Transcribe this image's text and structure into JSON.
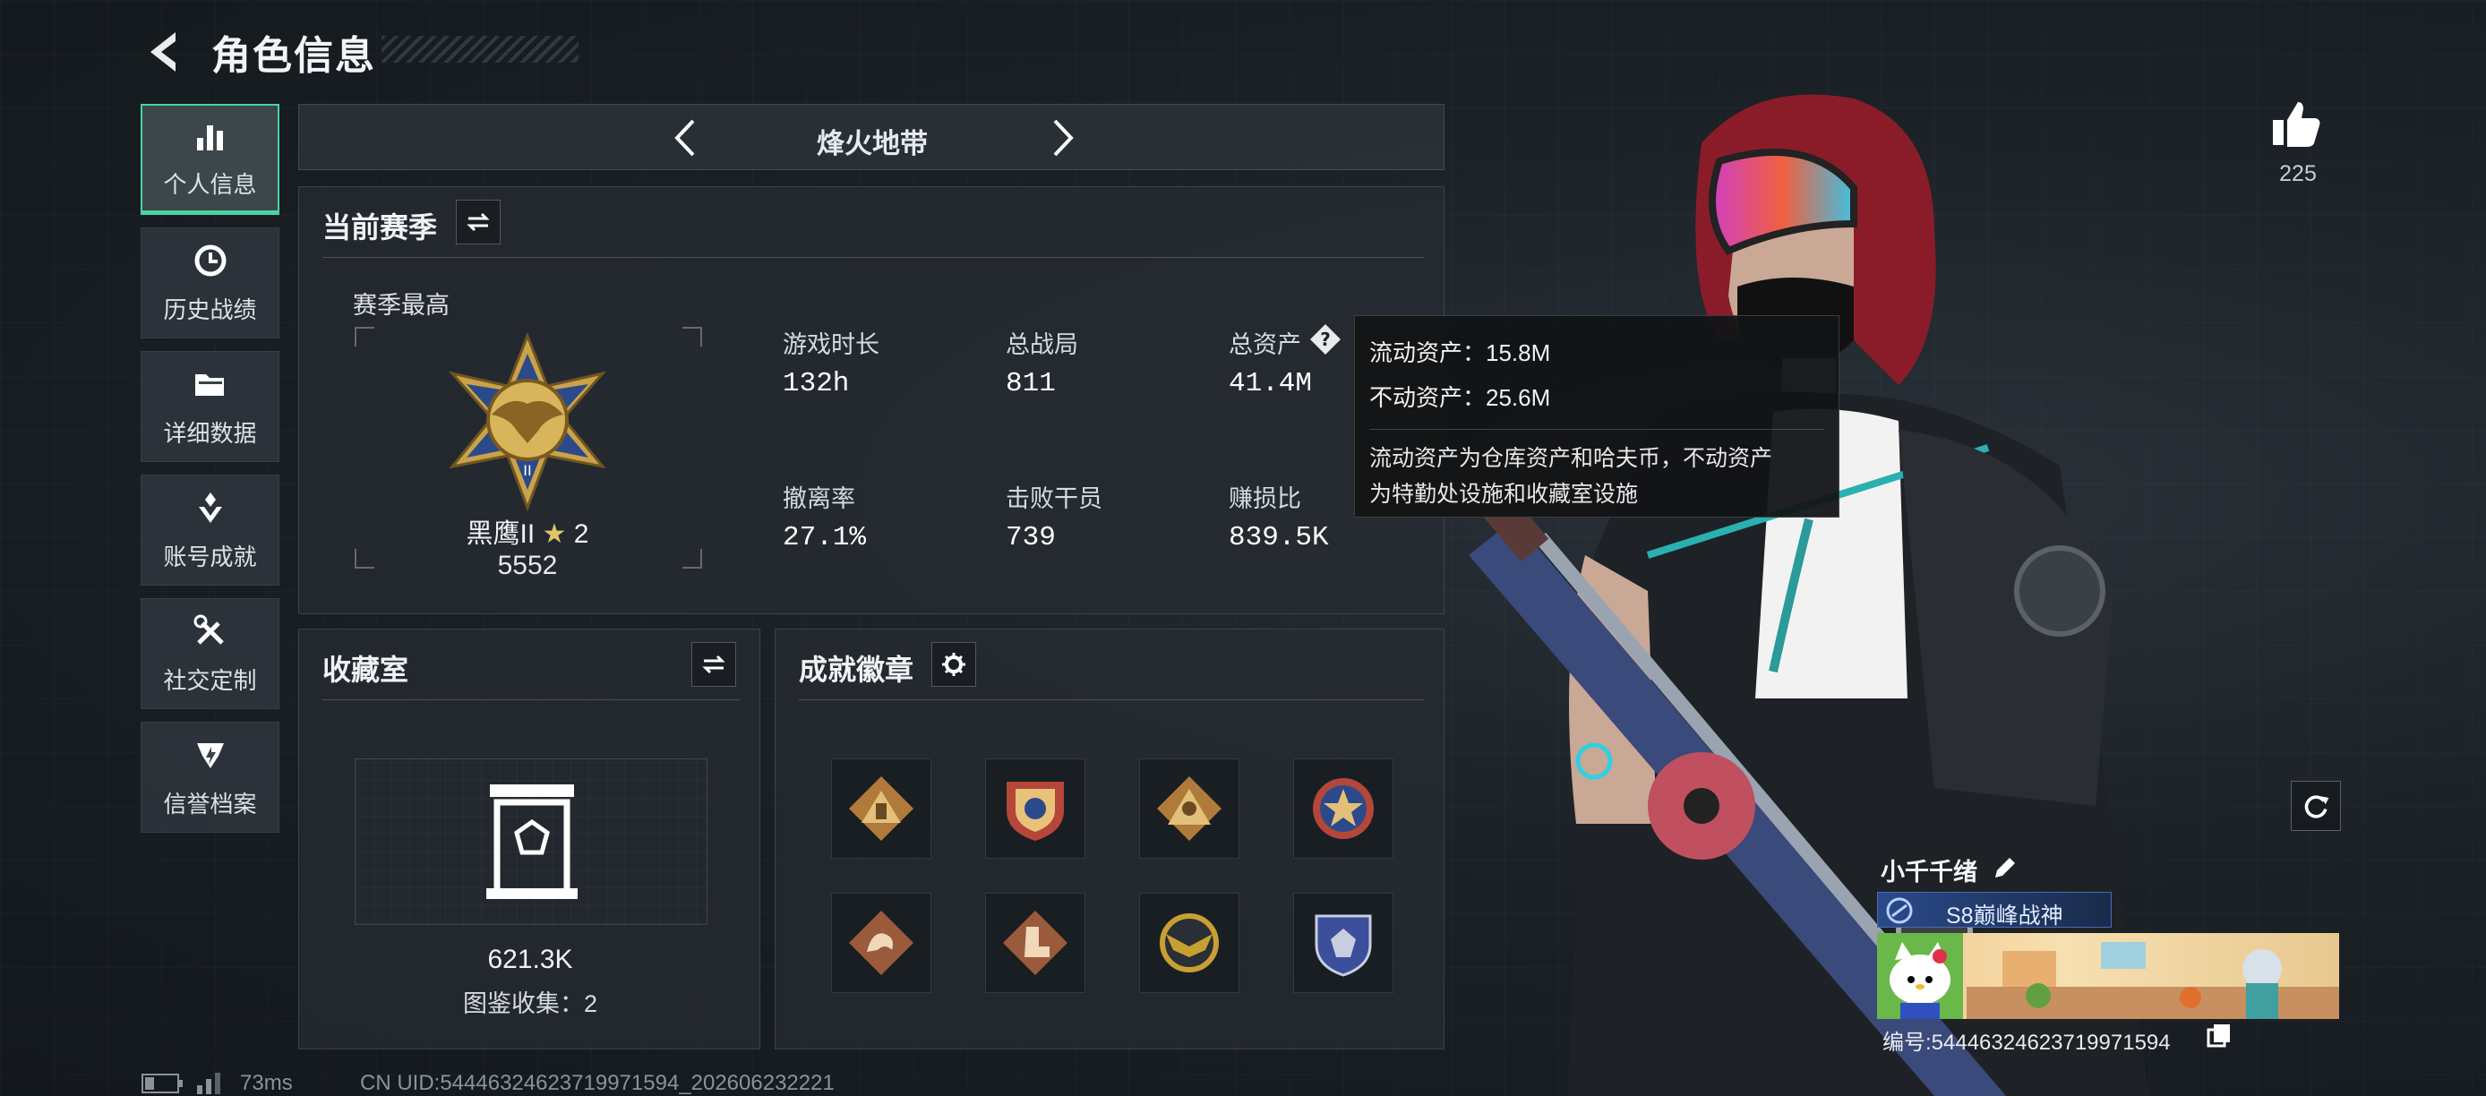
{
  "header": {
    "title": "角色信息"
  },
  "sidebar": {
    "items": [
      {
        "label": "个人信息",
        "icon": "bar-chart-icon",
        "active": true
      },
      {
        "label": "历史战绩",
        "icon": "clock-icon"
      },
      {
        "label": "详细数据",
        "icon": "folder-icon"
      },
      {
        "label": "账号成就",
        "icon": "achievement-icon"
      },
      {
        "label": "社交定制",
        "icon": "tools-icon"
      },
      {
        "label": "信誉档案",
        "icon": "shield-emblem-icon"
      }
    ]
  },
  "mode_selector": {
    "label": "烽火地带"
  },
  "season": {
    "title": "当前赛季",
    "best_label": "赛季最高",
    "rank_name": "黑鹰II",
    "rank_stars": "2",
    "rank_score": "5552",
    "stats": [
      {
        "label": "游戏时长",
        "value": "132h"
      },
      {
        "label": "总战局",
        "value": "811"
      },
      {
        "label": "总资产",
        "value": "41.4M"
      },
      {
        "label": "撤离率",
        "value": "27.1%"
      },
      {
        "label": "击败干员",
        "value": "739"
      },
      {
        "label": "赚损比",
        "value": "839.5K"
      }
    ]
  },
  "tooltip": {
    "liquid": "流动资产：15.8M",
    "fixed": "不动资产：25.6M",
    "desc_line1": "流动资产为仓库资产和哈夫币，不动资产",
    "desc_line2": "为特勤处设施和收藏室设施"
  },
  "collection": {
    "title": "收藏室",
    "value": "621.3K",
    "count_text": "图鉴收集：2"
  },
  "badges": {
    "title": "成就徽章",
    "items": [
      {
        "icon": "triangle-tower-badge-icon",
        "color": "#b07b3a"
      },
      {
        "icon": "shield-blue-badge-icon",
        "color": "#b5463a"
      },
      {
        "icon": "triangle-figure-badge-icon",
        "color": "#b07b3a"
      },
      {
        "icon": "star-wreath-badge-icon",
        "color": "#b5463a"
      },
      {
        "icon": "dragon-diamond-badge-icon",
        "color": "#9a5a3c"
      },
      {
        "icon": "boot-diamond-badge-icon",
        "color": "#9a5a3c"
      },
      {
        "icon": "gold-winged-badge-icon",
        "color": "#c8a032"
      },
      {
        "icon": "blue-shield-badge-icon",
        "color": "#3c4f9a"
      }
    ]
  },
  "likes": {
    "count": "225"
  },
  "player": {
    "name": "小千千绪",
    "title_badge": "S8巅峰战神",
    "id_text": "编号:5444632462371997159­4"
  },
  "footer": {
    "ping": "73ms",
    "uid": "CN UID:5444632462371997159­4_202606232221"
  },
  "colors": {
    "accent": "#4bd3a2",
    "tooltip_bg": "#121416"
  }
}
